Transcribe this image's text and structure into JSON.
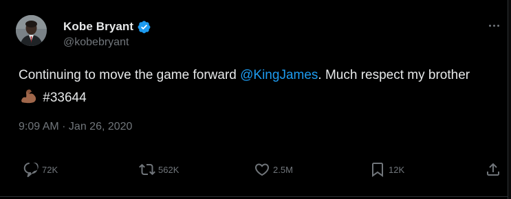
{
  "author": {
    "display_name": "Kobe Bryant",
    "handle": "@kobebryant",
    "verified": true
  },
  "tweet": {
    "text_before": "Continuing to move the game forward ",
    "mention": "@KingJames",
    "text_after": ". Much respect my brother ",
    "emoji": "flexed-biceps-icon",
    "hashtag": " #33644",
    "timestamp": "9:09 AM · Jan 26, 2020"
  },
  "actions": {
    "replies": "72K",
    "reposts": "562K",
    "likes": "2.5M",
    "bookmarks": "12K"
  },
  "colors": {
    "background": "#000000",
    "text": "#e7e9ea",
    "secondary": "#71767b",
    "accent": "#1d9bf0"
  }
}
